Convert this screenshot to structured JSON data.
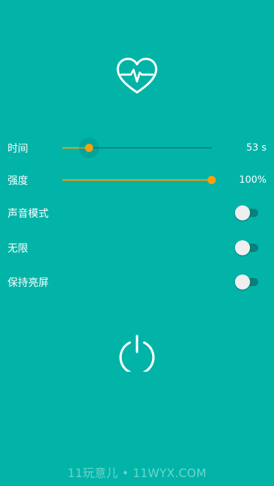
{
  "app": {
    "logo_icon": "heart-pulse-icon",
    "accent_color": "#F29A0F",
    "background_color": "#02B4A8"
  },
  "settings": {
    "time": {
      "label": "时间",
      "value_text": "53 s",
      "fraction": 0.18
    },
    "intensity": {
      "label": "强度",
      "value_text": "100%",
      "fraction": 1.0
    },
    "sound_mode": {
      "label": "声音模式",
      "on": false
    },
    "unlimited": {
      "label": "无限",
      "on": false
    },
    "keep_screen_on": {
      "label": "保持亮屏",
      "on": false
    }
  },
  "power": {
    "icon": "power-icon"
  },
  "watermark": "11玩意儿 • 11WYX.COM"
}
